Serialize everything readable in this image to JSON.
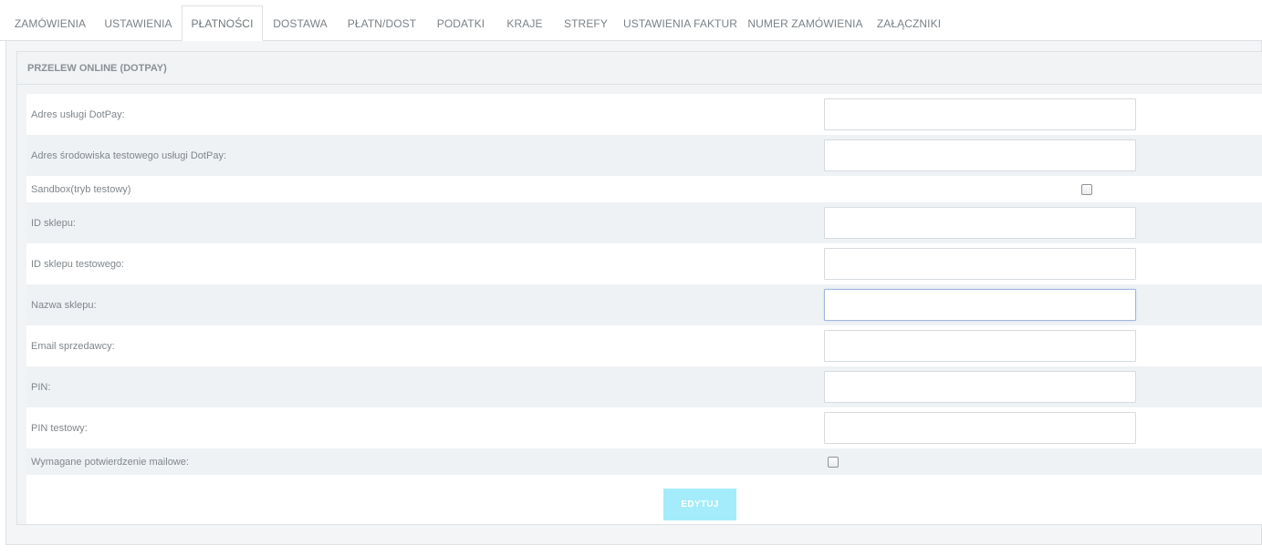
{
  "tabs": [
    {
      "label": "ZAMÓWIENIA",
      "active": false
    },
    {
      "label": "USTAWIENIA",
      "active": false
    },
    {
      "label": "PŁATNOŚCI",
      "active": true
    },
    {
      "label": "DOSTAWA",
      "active": false
    },
    {
      "label": "PŁATN/DOST",
      "active": false
    },
    {
      "label": "PODATKI",
      "active": false
    },
    {
      "label": "KRAJE",
      "active": false
    },
    {
      "label": "STREFY",
      "active": false
    },
    {
      "label": "USTAWIENIA FAKTUR",
      "active": false
    },
    {
      "label": "NUMER ZAMÓWIENIA",
      "active": false
    },
    {
      "label": "ZAŁĄCZNIKI",
      "active": false
    }
  ],
  "panel": {
    "title": "PRZELEW ONLINE (DOTPAY)"
  },
  "form": {
    "fields": [
      {
        "label": "Adres usługi DotPay:",
        "type": "text",
        "value": ""
      },
      {
        "label": "Adres środowiska testowego usługi DotPay:",
        "type": "text",
        "value": ""
      },
      {
        "label": "Sandbox(tryb testowy)",
        "type": "checkbox",
        "checked": false
      },
      {
        "label": "ID sklepu:",
        "type": "text",
        "value": ""
      },
      {
        "label": "ID sklepu testowego:",
        "type": "text",
        "value": ""
      },
      {
        "label": "Nazwa sklepu:",
        "type": "text",
        "value": "",
        "focused": true
      },
      {
        "label": "Email sprzedawcy:",
        "type": "text",
        "value": ""
      },
      {
        "label": "PIN:",
        "type": "text",
        "value": ""
      },
      {
        "label": "PIN testowy:",
        "type": "text",
        "value": ""
      },
      {
        "label": "Wymagane potwierdzenie mailowe:",
        "type": "checkbox",
        "checked": false
      }
    ],
    "submit_label": "EDYTUJ"
  },
  "colors": {
    "button": "#a4ecfb",
    "focus_border": "#9fb8de"
  }
}
